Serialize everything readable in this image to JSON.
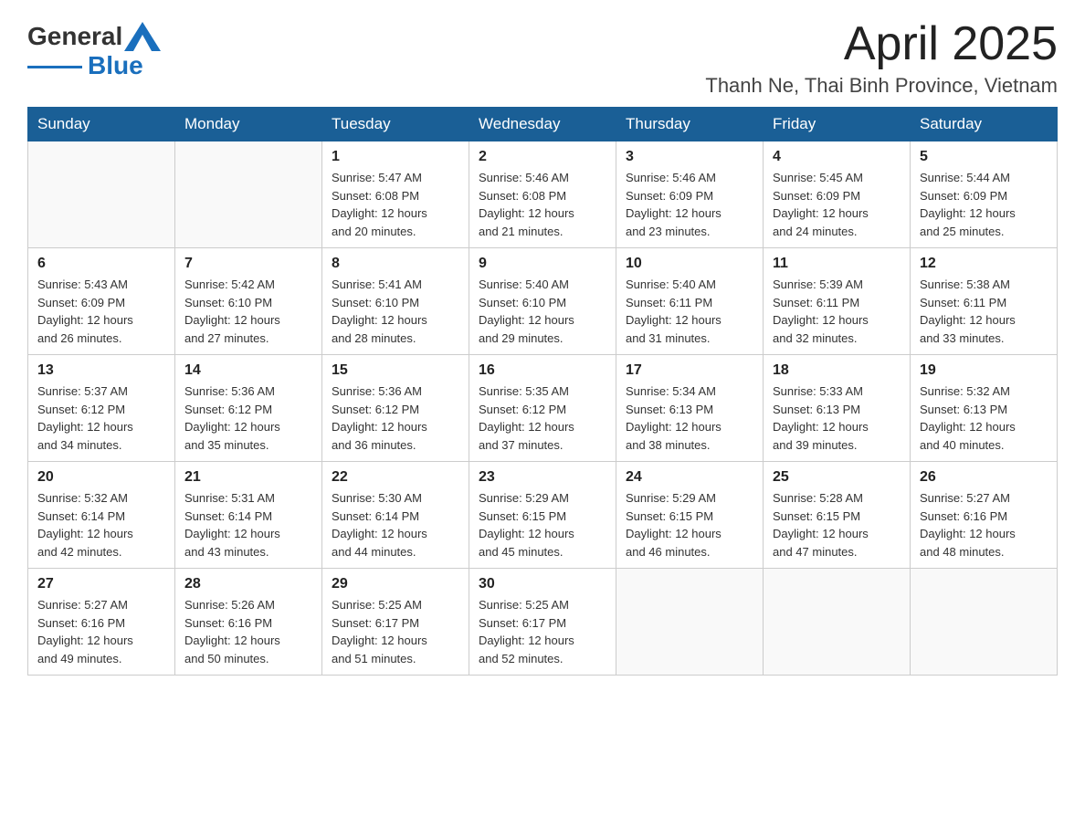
{
  "header": {
    "logo": {
      "general": "General",
      "blue": "Blue"
    },
    "title": "April 2025",
    "location": "Thanh Ne, Thai Binh Province, Vietnam"
  },
  "weekdays": [
    "Sunday",
    "Monday",
    "Tuesday",
    "Wednesday",
    "Thursday",
    "Friday",
    "Saturday"
  ],
  "weeks": [
    [
      {
        "day": "",
        "info": ""
      },
      {
        "day": "",
        "info": ""
      },
      {
        "day": "1",
        "info": "Sunrise: 5:47 AM\nSunset: 6:08 PM\nDaylight: 12 hours\nand 20 minutes."
      },
      {
        "day": "2",
        "info": "Sunrise: 5:46 AM\nSunset: 6:08 PM\nDaylight: 12 hours\nand 21 minutes."
      },
      {
        "day": "3",
        "info": "Sunrise: 5:46 AM\nSunset: 6:09 PM\nDaylight: 12 hours\nand 23 minutes."
      },
      {
        "day": "4",
        "info": "Sunrise: 5:45 AM\nSunset: 6:09 PM\nDaylight: 12 hours\nand 24 minutes."
      },
      {
        "day": "5",
        "info": "Sunrise: 5:44 AM\nSunset: 6:09 PM\nDaylight: 12 hours\nand 25 minutes."
      }
    ],
    [
      {
        "day": "6",
        "info": "Sunrise: 5:43 AM\nSunset: 6:09 PM\nDaylight: 12 hours\nand 26 minutes."
      },
      {
        "day": "7",
        "info": "Sunrise: 5:42 AM\nSunset: 6:10 PM\nDaylight: 12 hours\nand 27 minutes."
      },
      {
        "day": "8",
        "info": "Sunrise: 5:41 AM\nSunset: 6:10 PM\nDaylight: 12 hours\nand 28 minutes."
      },
      {
        "day": "9",
        "info": "Sunrise: 5:40 AM\nSunset: 6:10 PM\nDaylight: 12 hours\nand 29 minutes."
      },
      {
        "day": "10",
        "info": "Sunrise: 5:40 AM\nSunset: 6:11 PM\nDaylight: 12 hours\nand 31 minutes."
      },
      {
        "day": "11",
        "info": "Sunrise: 5:39 AM\nSunset: 6:11 PM\nDaylight: 12 hours\nand 32 minutes."
      },
      {
        "day": "12",
        "info": "Sunrise: 5:38 AM\nSunset: 6:11 PM\nDaylight: 12 hours\nand 33 minutes."
      }
    ],
    [
      {
        "day": "13",
        "info": "Sunrise: 5:37 AM\nSunset: 6:12 PM\nDaylight: 12 hours\nand 34 minutes."
      },
      {
        "day": "14",
        "info": "Sunrise: 5:36 AM\nSunset: 6:12 PM\nDaylight: 12 hours\nand 35 minutes."
      },
      {
        "day": "15",
        "info": "Sunrise: 5:36 AM\nSunset: 6:12 PM\nDaylight: 12 hours\nand 36 minutes."
      },
      {
        "day": "16",
        "info": "Sunrise: 5:35 AM\nSunset: 6:12 PM\nDaylight: 12 hours\nand 37 minutes."
      },
      {
        "day": "17",
        "info": "Sunrise: 5:34 AM\nSunset: 6:13 PM\nDaylight: 12 hours\nand 38 minutes."
      },
      {
        "day": "18",
        "info": "Sunrise: 5:33 AM\nSunset: 6:13 PM\nDaylight: 12 hours\nand 39 minutes."
      },
      {
        "day": "19",
        "info": "Sunrise: 5:32 AM\nSunset: 6:13 PM\nDaylight: 12 hours\nand 40 minutes."
      }
    ],
    [
      {
        "day": "20",
        "info": "Sunrise: 5:32 AM\nSunset: 6:14 PM\nDaylight: 12 hours\nand 42 minutes."
      },
      {
        "day": "21",
        "info": "Sunrise: 5:31 AM\nSunset: 6:14 PM\nDaylight: 12 hours\nand 43 minutes."
      },
      {
        "day": "22",
        "info": "Sunrise: 5:30 AM\nSunset: 6:14 PM\nDaylight: 12 hours\nand 44 minutes."
      },
      {
        "day": "23",
        "info": "Sunrise: 5:29 AM\nSunset: 6:15 PM\nDaylight: 12 hours\nand 45 minutes."
      },
      {
        "day": "24",
        "info": "Sunrise: 5:29 AM\nSunset: 6:15 PM\nDaylight: 12 hours\nand 46 minutes."
      },
      {
        "day": "25",
        "info": "Sunrise: 5:28 AM\nSunset: 6:15 PM\nDaylight: 12 hours\nand 47 minutes."
      },
      {
        "day": "26",
        "info": "Sunrise: 5:27 AM\nSunset: 6:16 PM\nDaylight: 12 hours\nand 48 minutes."
      }
    ],
    [
      {
        "day": "27",
        "info": "Sunrise: 5:27 AM\nSunset: 6:16 PM\nDaylight: 12 hours\nand 49 minutes."
      },
      {
        "day": "28",
        "info": "Sunrise: 5:26 AM\nSunset: 6:16 PM\nDaylight: 12 hours\nand 50 minutes."
      },
      {
        "day": "29",
        "info": "Sunrise: 5:25 AM\nSunset: 6:17 PM\nDaylight: 12 hours\nand 51 minutes."
      },
      {
        "day": "30",
        "info": "Sunrise: 5:25 AM\nSunset: 6:17 PM\nDaylight: 12 hours\nand 52 minutes."
      },
      {
        "day": "",
        "info": ""
      },
      {
        "day": "",
        "info": ""
      },
      {
        "day": "",
        "info": ""
      }
    ]
  ]
}
